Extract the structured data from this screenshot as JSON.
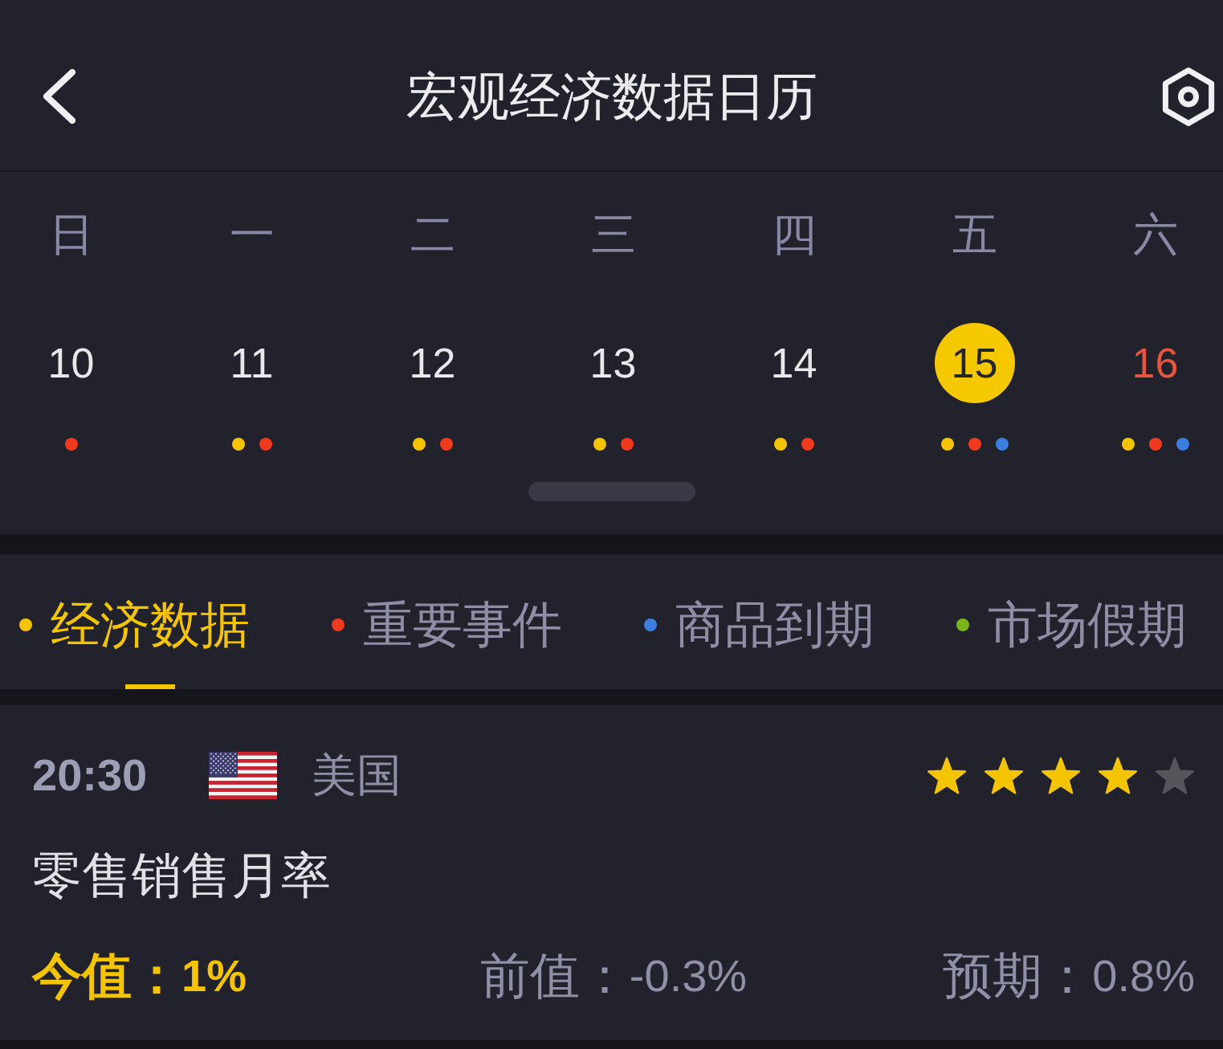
{
  "header": {
    "title": "宏观经济数据日历"
  },
  "calendar": {
    "weekdays": [
      "日",
      "一",
      "二",
      "三",
      "四",
      "五",
      "六"
    ],
    "days": [
      {
        "date": "10",
        "selected": false,
        "today": false,
        "events": [
          {
            "color": "#f03a1e"
          }
        ]
      },
      {
        "date": "11",
        "selected": false,
        "today": false,
        "events": [
          {
            "color": "#f5c400"
          },
          {
            "color": "#f03a1e"
          }
        ]
      },
      {
        "date": "12",
        "selected": false,
        "today": false,
        "events": [
          {
            "color": "#f5c400"
          },
          {
            "color": "#f03a1e"
          }
        ]
      },
      {
        "date": "13",
        "selected": false,
        "today": false,
        "events": [
          {
            "color": "#f5c400"
          },
          {
            "color": "#f03a1e"
          }
        ]
      },
      {
        "date": "14",
        "selected": false,
        "today": false,
        "events": [
          {
            "color": "#f5c400"
          },
          {
            "color": "#f03a1e"
          }
        ]
      },
      {
        "date": "15",
        "selected": true,
        "today": false,
        "events": [
          {
            "color": "#f5c400"
          },
          {
            "color": "#f03a1e"
          },
          {
            "color": "#3a7ee0"
          }
        ]
      },
      {
        "date": "16",
        "selected": false,
        "today": true,
        "events": [
          {
            "color": "#f5c400"
          },
          {
            "color": "#f03a1e"
          },
          {
            "color": "#3a7ee0"
          }
        ]
      }
    ]
  },
  "tabs": [
    {
      "label": "经济数据",
      "color": "#f5c400",
      "selected": true
    },
    {
      "label": "重要事件",
      "color": "#f03a1e",
      "selected": false
    },
    {
      "label": "商品到期",
      "color": "#3a7ee0",
      "selected": false
    },
    {
      "label": "市场假期",
      "color": "#7cb51a",
      "selected": false
    }
  ],
  "event": {
    "time": "20:30",
    "country": "美国",
    "stars": 4,
    "title": "零售销售月率",
    "figures": [
      {
        "kind": "actual",
        "label": "今值：",
        "value": "1%"
      },
      {
        "kind": "previous",
        "label": "前值：",
        "value": "-0.3%"
      },
      {
        "kind": "forecast",
        "label": "预期：",
        "value": "0.8%"
      }
    ]
  }
}
